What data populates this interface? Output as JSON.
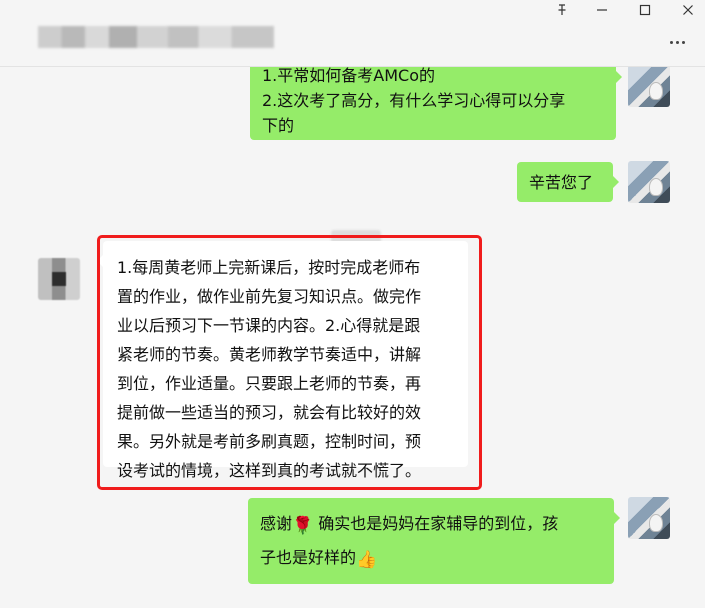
{
  "window": {
    "pin_icon": "pin-icon",
    "buttons": [
      "minimize",
      "maximize",
      "close"
    ],
    "more_icon": "ellipsis-icon"
  },
  "messages": [
    {
      "sender": "me",
      "lines": [
        "1.平常如何备考AMCo的",
        "2.这次考了高分，有什么学习心得可以分享",
        "下的"
      ]
    },
    {
      "sender": "me",
      "text": "辛苦您了"
    },
    {
      "sender": "other",
      "lines": [
        "1.每周黄老师上完新课后，按时完成老师布",
        "置的作业，做作业前先复习知识点。做完作",
        "业以后预习下一节课的内容。2.心得就是跟",
        "紧老师的节奏。黄老师教学节奏适中，讲解",
        "到位，作业适量。只要跟上老师的节奏，再",
        "提前做一些适当的预习，就会有比较好的效",
        "果。另外就是考前多刷真题，控制时间，预",
        "设考试的情境，这样到真的考试就不慌了。"
      ]
    },
    {
      "sender": "me",
      "part1": "感谢",
      "emoji1": "🌹",
      "part2": " 确实也是妈妈在家辅导的到位，孩",
      "line2": "子也是好样的",
      "emoji2": "👍"
    }
  ],
  "colors": {
    "my_bubble": "#95ec69",
    "other_bubble": "#ffffff",
    "highlight_border": "#f01c1c",
    "background": "#f5f5f5"
  }
}
